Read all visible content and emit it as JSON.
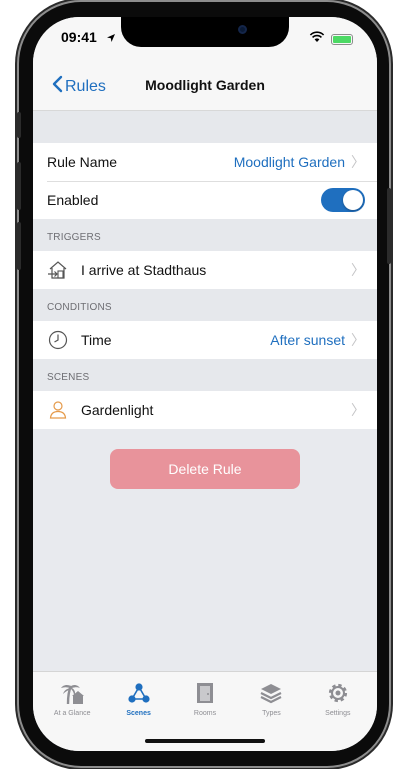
{
  "status_bar": {
    "time": "09:41"
  },
  "nav": {
    "back_label": "Rules",
    "title": "Moodlight Garden"
  },
  "settings": {
    "rule_name_label": "Rule Name",
    "rule_name_value": "Moodlight Garden",
    "enabled_label": "Enabled",
    "enabled": true
  },
  "triggers": {
    "header": "TRIGGERS",
    "item_label": "I arrive at Stadthaus",
    "icon": "arrive-home-icon"
  },
  "conditions": {
    "header": "CONDITIONS",
    "item_label": "Time",
    "item_value": "After sunset",
    "icon": "clock-icon"
  },
  "scenes": {
    "header": "SCENES",
    "item_label": "Gardenlight",
    "icon": "person-icon"
  },
  "delete_label": "Delete Rule",
  "tabs": [
    {
      "label": "At a Glance",
      "icon": "glance-icon",
      "active": false
    },
    {
      "label": "Scenes",
      "icon": "scenes-icon",
      "active": true
    },
    {
      "label": "Rooms",
      "icon": "rooms-icon",
      "active": false
    },
    {
      "label": "Types",
      "icon": "types-icon",
      "active": false
    },
    {
      "label": "Settings",
      "icon": "settings-gear-icon",
      "active": false
    }
  ],
  "colors": {
    "accent": "#1f6fbf",
    "delete": "#e8939b",
    "toggle_on": "#1f6fbf"
  }
}
